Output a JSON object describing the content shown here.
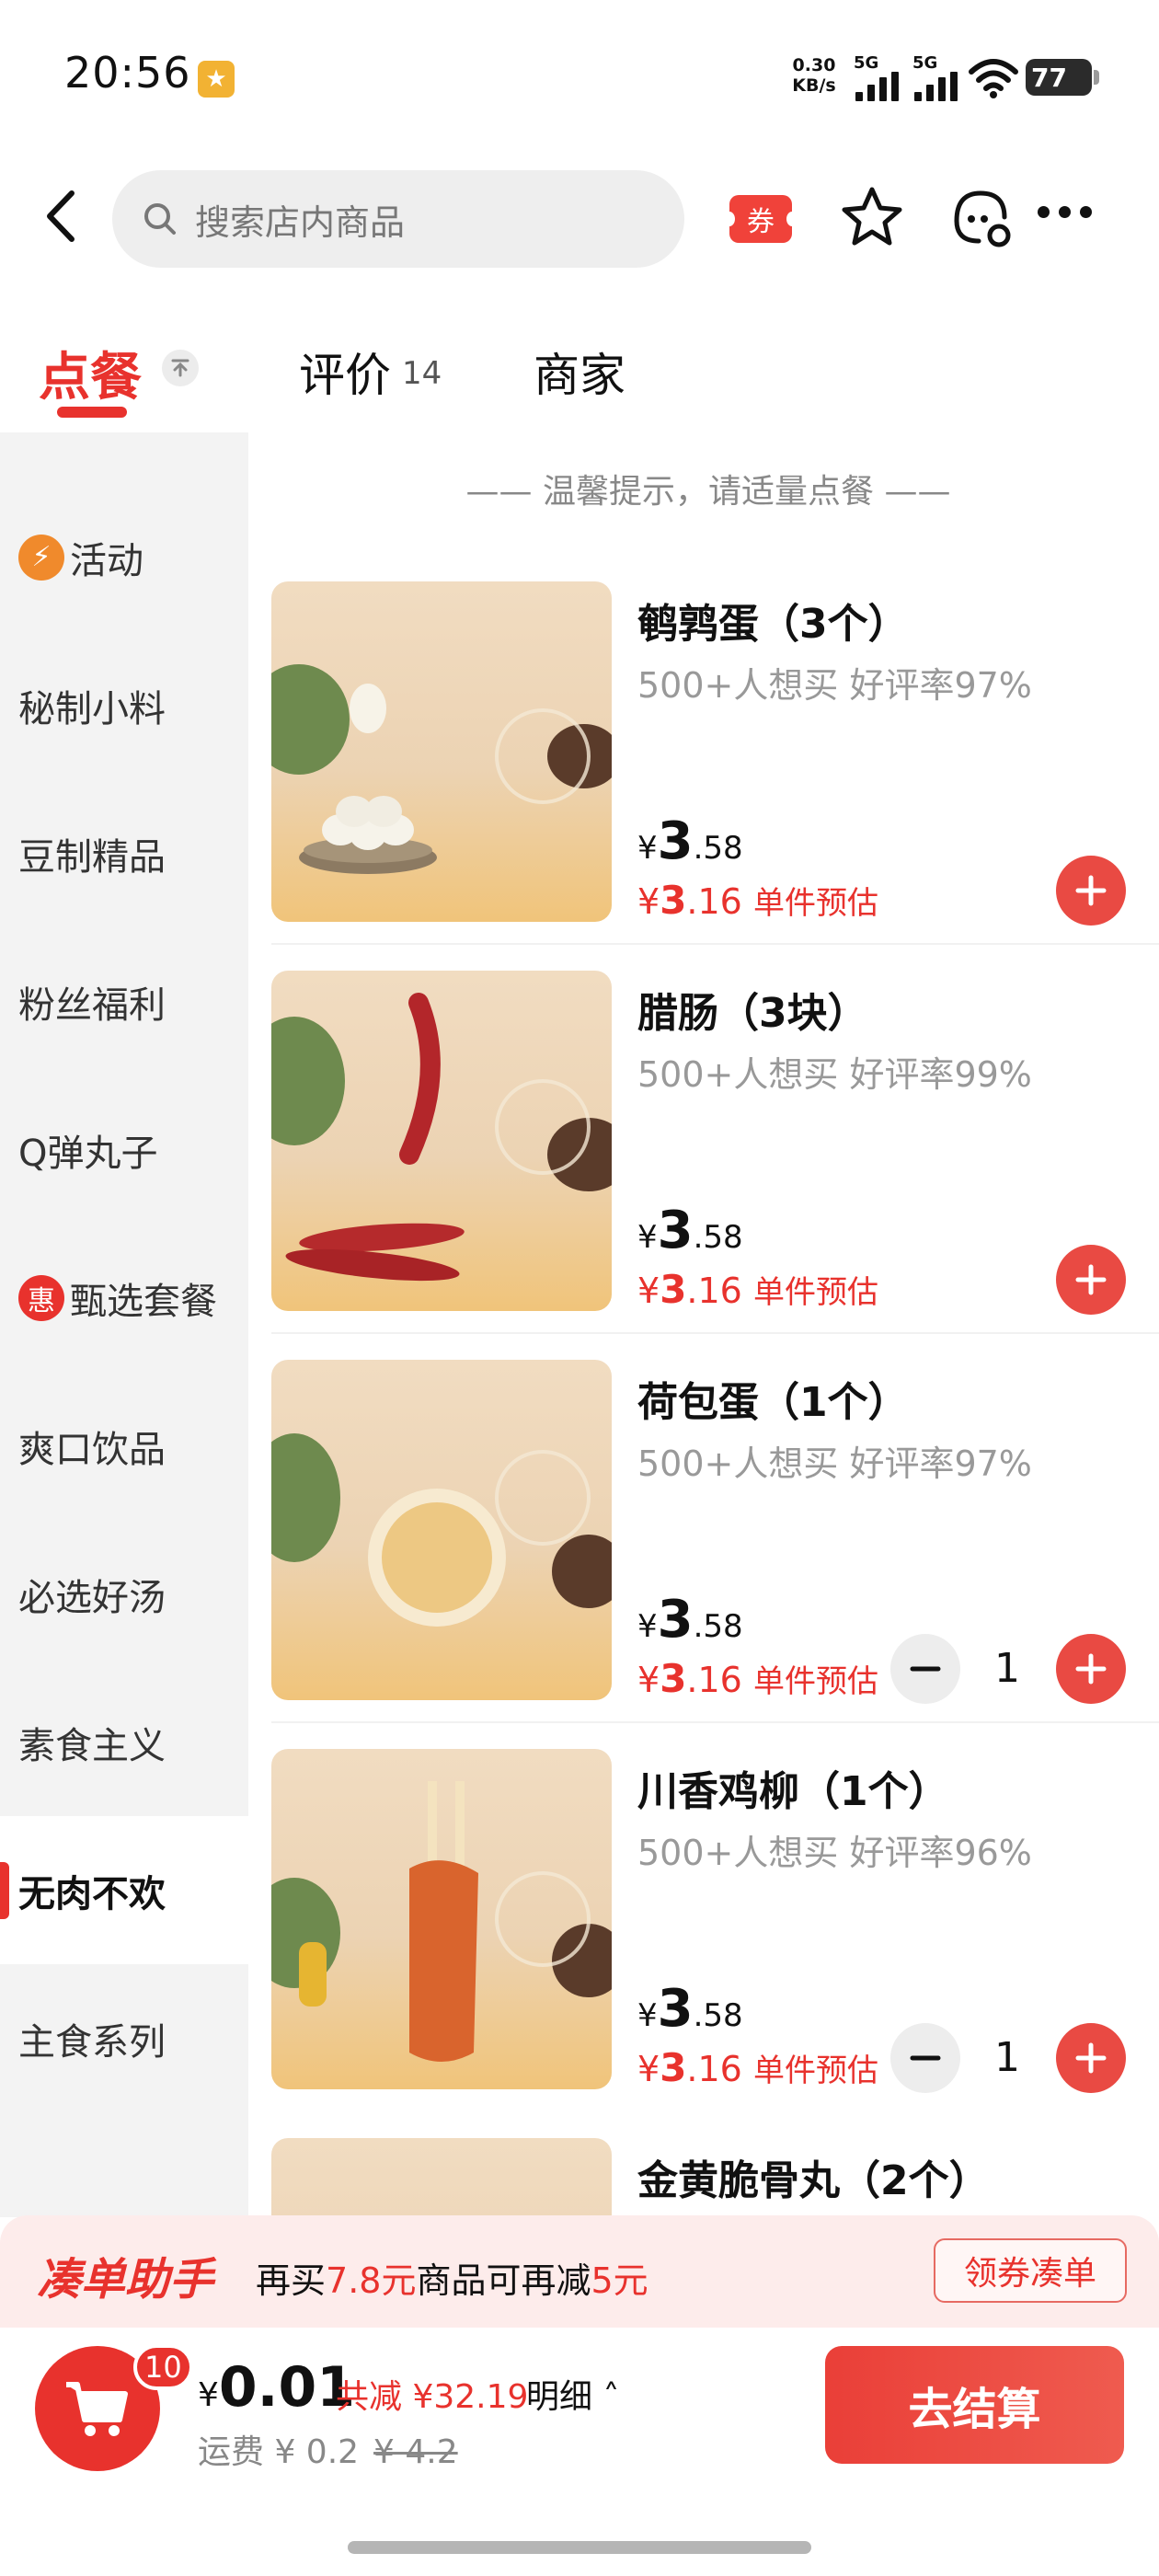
{
  "status_bar": {
    "time": "20:56",
    "net_speed_value": "0.30",
    "net_speed_unit": "KB/s",
    "signal_1": "5G",
    "signal_2": "5G",
    "battery": "77"
  },
  "header": {
    "search_placeholder": "搜索店内商品",
    "coupon_label": "券",
    "icons": [
      "back-arrow-icon",
      "search-icon",
      "star-icon",
      "customer-service-icon",
      "more-icon"
    ]
  },
  "tabs": {
    "order": "点餐",
    "reviews": "评价",
    "reviews_count": "14",
    "shop": "商家"
  },
  "sidebar": {
    "items": [
      {
        "label": "活动",
        "badge": "⚡",
        "badge_color": "#f08a2c"
      },
      {
        "label": "秘制小料"
      },
      {
        "label": "豆制精品"
      },
      {
        "label": "粉丝福利"
      },
      {
        "label": "Q弹丸子"
      },
      {
        "label": "甄选套餐",
        "badge": "惠",
        "badge_color": "#e8322d"
      },
      {
        "label": "爽口饮品"
      },
      {
        "label": "必选好汤"
      },
      {
        "label": "素食主义"
      },
      {
        "label": "无肉不欢",
        "active": true
      },
      {
        "label": "主食系列"
      }
    ]
  },
  "main": {
    "tip": "温馨提示，请适量点餐",
    "items": [
      {
        "name": "鹌鹑蛋（3个）",
        "stats": "500+人想买 好评率97%",
        "currency": "¥",
        "price_int": "3",
        "price_dec": ".58",
        "est_int": "3",
        "est_dec": ".16",
        "est_label": "单件预估",
        "qty": null
      },
      {
        "name": "腊肠（3块）",
        "stats": "500+人想买 好评率99%",
        "currency": "¥",
        "price_int": "3",
        "price_dec": ".58",
        "est_int": "3",
        "est_dec": ".16",
        "est_label": "单件预估",
        "qty": null
      },
      {
        "name": "荷包蛋（1个）",
        "stats": "500+人想买 好评率97%",
        "currency": "¥",
        "price_int": "3",
        "price_dec": ".58",
        "est_int": "3",
        "est_dec": ".16",
        "est_label": "单件预估",
        "qty": "1"
      },
      {
        "name": "川香鸡柳（1个）",
        "stats": "500+人想买 好评率96%",
        "currency": "¥",
        "price_int": "3",
        "price_dec": ".58",
        "est_int": "3",
        "est_dec": ".16",
        "est_label": "单件预估",
        "qty": "1"
      },
      {
        "name": "金黄脆骨丸（2个）"
      }
    ]
  },
  "helper": {
    "title": "凑单助手",
    "text_1": "再买",
    "amount": "7.8元",
    "text_2": "商品可再减",
    "reduce": "5元",
    "button": "领券凑单"
  },
  "checkout": {
    "cart_count": "10",
    "currency": "¥",
    "total": "0.01",
    "discount": "共减 ¥32.19",
    "detail": "明细",
    "delivery": "运费 ¥ 0.2",
    "delivery_original": "¥ 4.2",
    "pay": "去结算"
  },
  "colors": {
    "accent": "#e8322d",
    "sidebar_bg": "#f3f3f3"
  }
}
